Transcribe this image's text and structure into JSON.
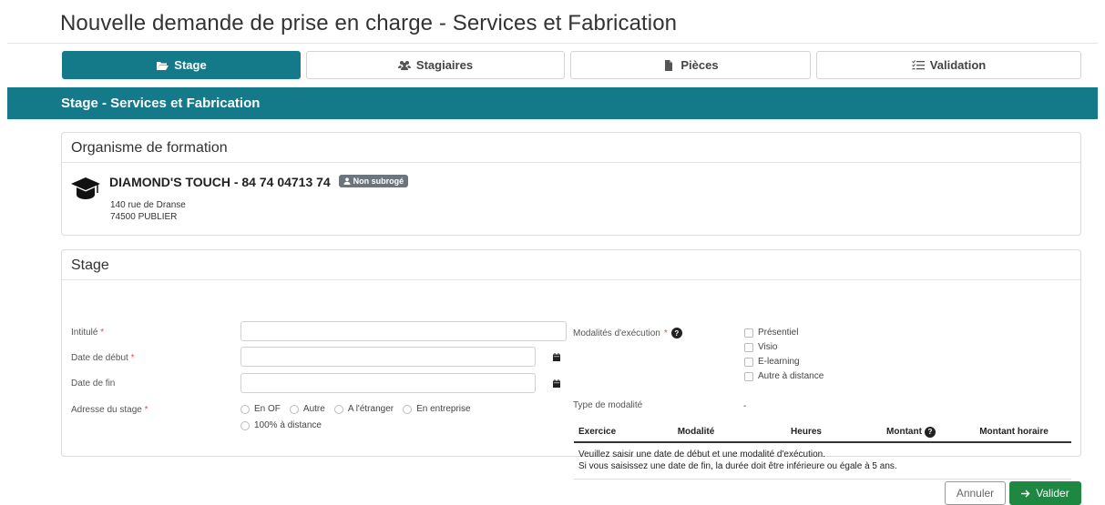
{
  "page": {
    "title": "Nouvelle demande de prise en charge - Services et Fabrication"
  },
  "steps": [
    {
      "label": "Stage",
      "icon": "folder-open-icon",
      "active": true
    },
    {
      "label": "Stagiaires",
      "icon": "users-icon",
      "active": false
    },
    {
      "label": "Pièces",
      "icon": "file-icon",
      "active": false
    },
    {
      "label": "Validation",
      "icon": "list-check-icon",
      "active": false
    }
  ],
  "banner": {
    "title": "Stage - Services et Fabrication"
  },
  "organisme": {
    "header": "Organisme de formation",
    "name": "DIAMOND'S TOUCH - 84 74 04713 74",
    "badge": "Non subrogé",
    "address_line1": "140 rue de Dranse",
    "address_line2": "74500 PUBLIER"
  },
  "stage": {
    "header": "Stage",
    "intitule_label": "Intitulé",
    "date_debut_label": "Date de début",
    "date_fin_label": "Date de fin",
    "adresse_label": "Adresse du stage",
    "adresse_options": [
      "En OF",
      "Autre",
      "A l'étranger",
      "En entreprise",
      "100% à distance"
    ],
    "modalites_label": "Modalités d'exécution",
    "modalites_options": [
      "Présentiel",
      "Visio",
      "E-learning",
      "Autre à distance"
    ],
    "type_modalite_label": "Type de modalité",
    "type_modalite_value": "-",
    "required_mark": "*",
    "table": {
      "headers": [
        "Exercice",
        "Modalité",
        "Heures",
        "Montant",
        "Montant horaire"
      ],
      "note_line1": "Veuillez saisir une date de début et une modalité d'exécution.",
      "note_line2": "Si vous saisissez une date de fin, la durée doit être inférieure ou égale à 5 ans."
    }
  },
  "actions": {
    "cancel_label": "Annuler",
    "submit_label": "Valider"
  },
  "colors": {
    "primary": "#147a8a",
    "success": "#1e8741",
    "required": "#d9534f"
  }
}
